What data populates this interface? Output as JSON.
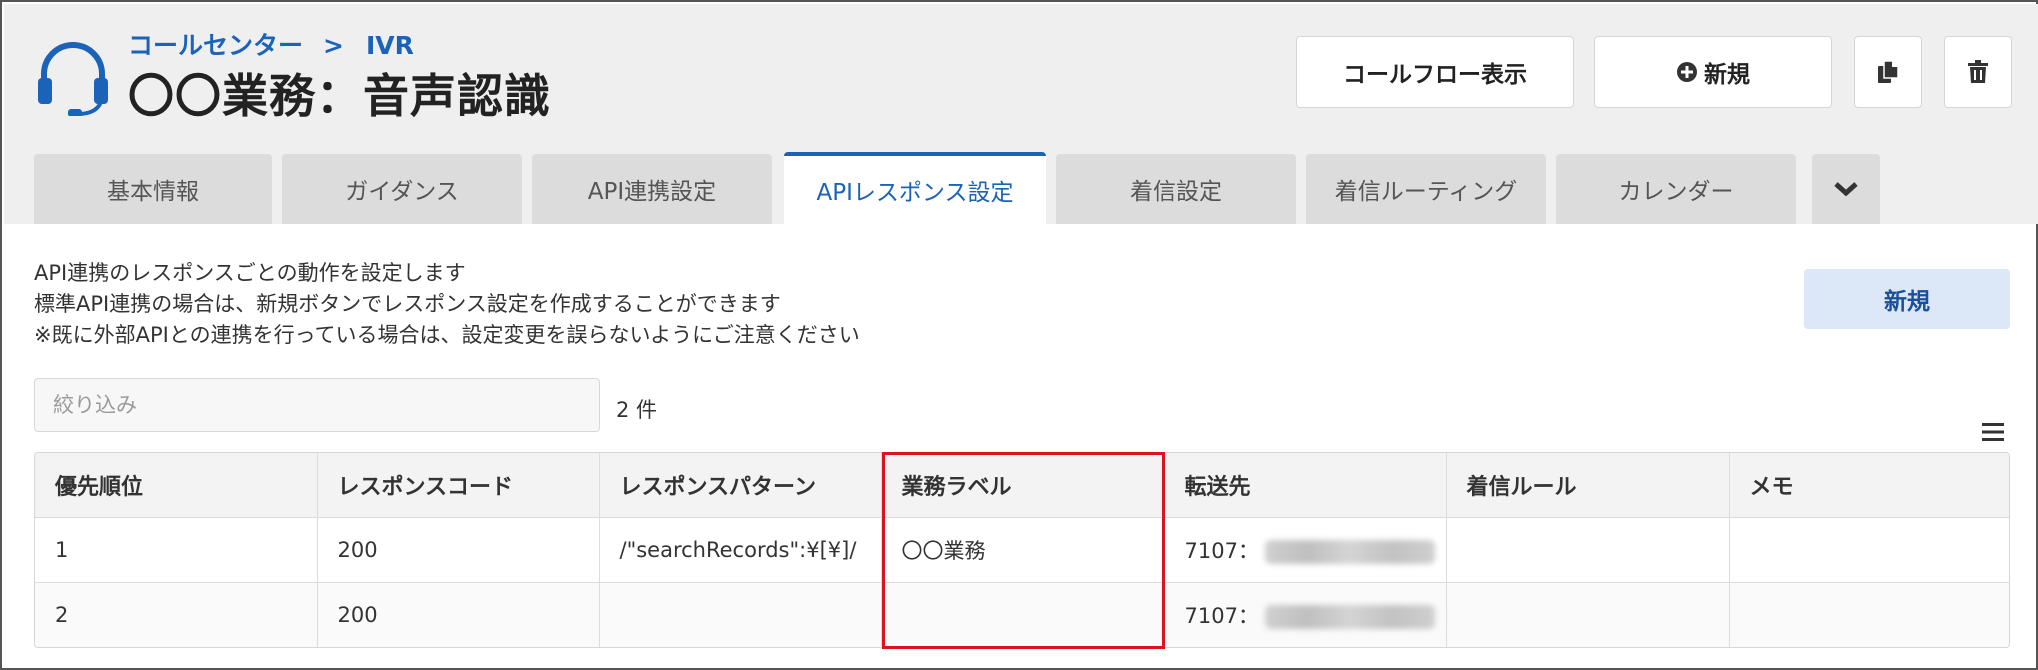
{
  "breadcrumb": {
    "parent": "コールセンター",
    "separator": ">",
    "current": "IVR"
  },
  "title": "〇〇業務：音声認識",
  "header_buttons": {
    "call_flow": "コールフロー表示",
    "new": "新規"
  },
  "tabs": [
    {
      "label": "基本情報",
      "active": false
    },
    {
      "label": "ガイダンス",
      "active": false
    },
    {
      "label": "API連携設定",
      "active": false
    },
    {
      "label": "APIレスポンス設定",
      "active": true
    },
    {
      "label": "着信設定",
      "active": false
    },
    {
      "label": "着信ルーティング",
      "active": false
    },
    {
      "label": "カレンダー",
      "active": false
    }
  ],
  "description": [
    "API連携のレスポンスごとの動作を設定します",
    "標準API連携の場合は、新規ボタンでレスポンス設定を作成することができます",
    "※既に外部APIとの連携を行っている場合は、設定変更を誤らないようにご注意ください"
  ],
  "new_button": "新規",
  "filter": {
    "placeholder": "絞り込み"
  },
  "count": "2 件",
  "table": {
    "columns": [
      "優先順位",
      "レスポンスコード",
      "レスポンスパターン",
      "業務ラベル",
      "転送先",
      "着信ルール",
      "メモ"
    ],
    "rows": [
      {
        "priority": "1",
        "code": "200",
        "pattern": "/\"searchRecords\":¥[¥]/",
        "label": "〇〇業務",
        "transfer": "7107：",
        "rule": "",
        "memo": ""
      },
      {
        "priority": "2",
        "code": "200",
        "pattern": "",
        "label": "",
        "transfer": "7107：",
        "rule": "",
        "memo": ""
      }
    ]
  },
  "colors": {
    "accent": "#1a63b8",
    "highlight": "#d9141c",
    "header_bg": "#efefef"
  },
  "icons": [
    "headset-icon",
    "plus-circle-icon",
    "copy-icon",
    "trash-icon",
    "chevron-down-icon",
    "menu-icon"
  ]
}
